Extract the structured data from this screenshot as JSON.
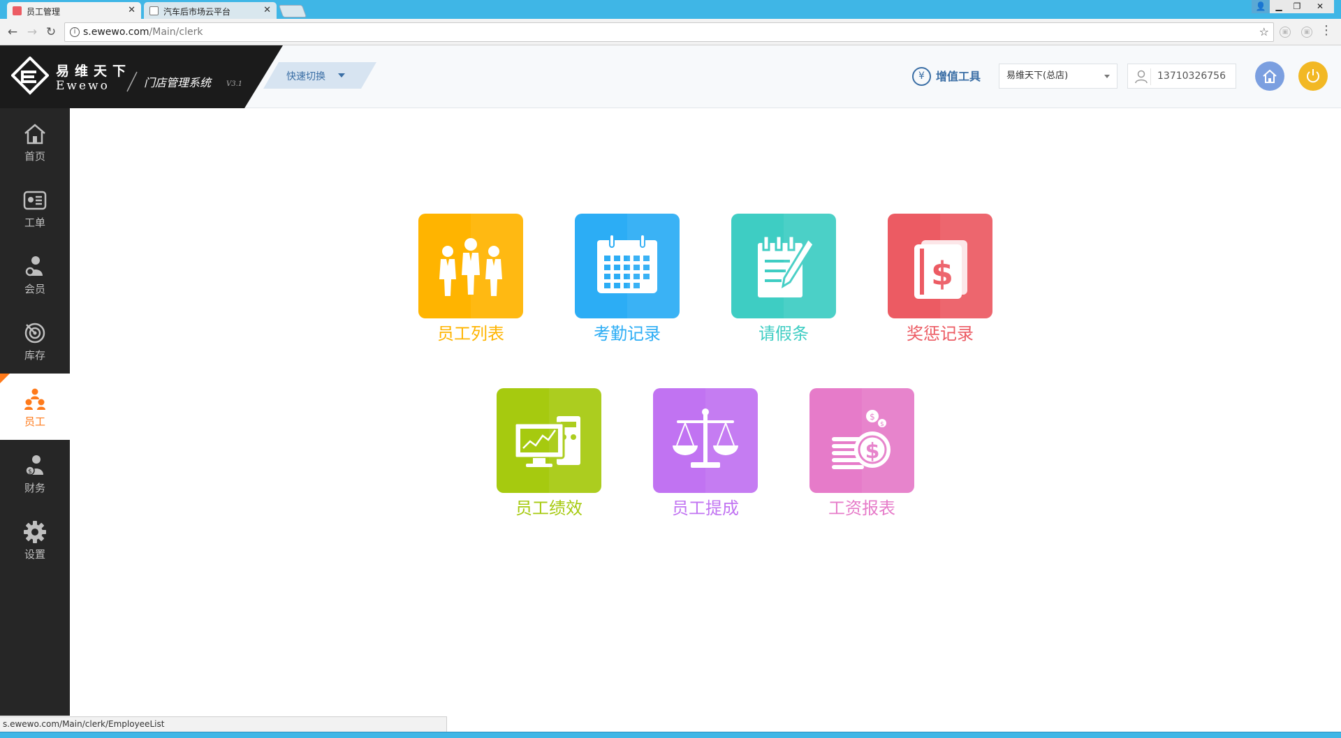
{
  "browser": {
    "tabs": [
      {
        "title": "员工管理",
        "active": true
      },
      {
        "title": "汽车后市场云平台",
        "active": false
      }
    ],
    "url_host": "s.ewewo.com",
    "url_path": "/Main/clerk",
    "status_url": "s.ewewo.com/Main/clerk/EmployeeList"
  },
  "header": {
    "logo_cn": "易维天下",
    "logo_en": "Ewewo",
    "system_name": "门店管理系统",
    "system_version": "V3.1",
    "quick_switch": "快速切换",
    "value_tools": "增值工具",
    "store": "易维天下(总店)",
    "user_phone": "13710326756"
  },
  "sidebar": {
    "items": [
      {
        "label": "首页",
        "icon": "home-icon"
      },
      {
        "label": "工单",
        "icon": "work-order-icon"
      },
      {
        "label": "会员",
        "icon": "member-icon"
      },
      {
        "label": "库存",
        "icon": "inventory-icon"
      },
      {
        "label": "员工",
        "icon": "staff-icon",
        "active": true
      },
      {
        "label": "财务",
        "icon": "finance-icon"
      },
      {
        "label": "设置",
        "icon": "settings-icon"
      }
    ]
  },
  "tiles": [
    {
      "label": "员工列表",
      "color": "#ffb400",
      "icon": "employee-list-icon"
    },
    {
      "label": "考勤记录",
      "color": "#2cadf5",
      "icon": "attendance-calendar-icon"
    },
    {
      "label": "请假条",
      "color": "#3ecdc3",
      "icon": "leave-note-icon"
    },
    {
      "label": "奖惩记录",
      "color": "#ec5b63",
      "icon": "reward-punish-icon"
    },
    {
      "label": "员工绩效",
      "color": "#a6ca0f",
      "icon": "performance-monitor-icon"
    },
    {
      "label": "员工提成",
      "color": "#c173f2",
      "icon": "commission-scale-icon"
    },
    {
      "label": "工资报表",
      "color": "#e67bc9",
      "icon": "salary-coins-icon"
    }
  ],
  "colors": {
    "sidebar_bg": "#262626",
    "accent_orange": "#ff7a1a",
    "header_blue": "#3a6ea5",
    "browser_blue": "#3fb6e6"
  }
}
